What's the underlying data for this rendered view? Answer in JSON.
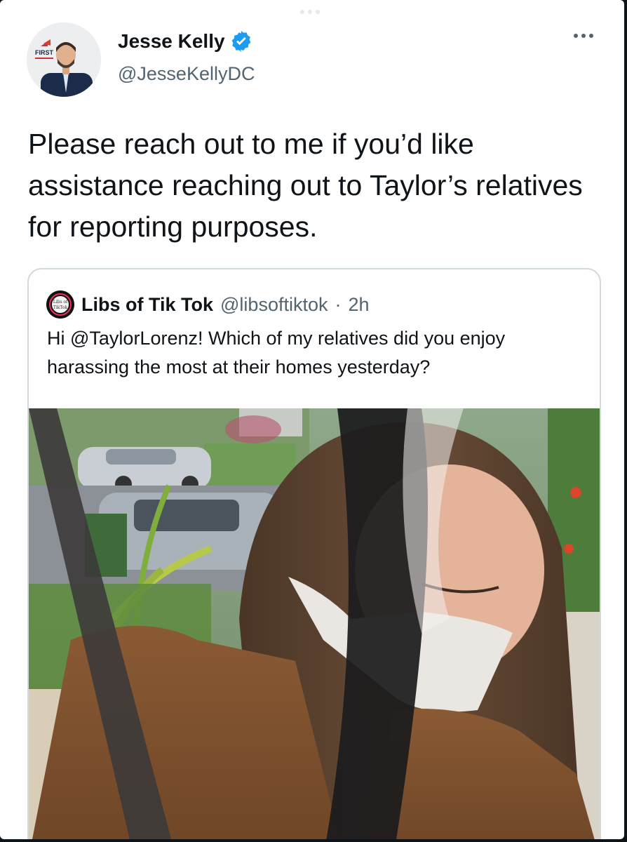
{
  "tweet": {
    "author_name": "Jesse Kelly",
    "author_handle": "@JesseKellyDC",
    "avatar_badge": "FIRST",
    "verified_icon": "verified-badge-icon",
    "text": "Please reach out to me if you’d like assistance reaching out to Taylor’s relatives for reporting purposes."
  },
  "quote": {
    "author_name": "Libs of Tik Tok",
    "author_handle": "@libsoftiktok",
    "separator": "·",
    "time": "2h",
    "avatar_text": "Libs of TikTok",
    "text": "Hi @TaylorLorenz! Which of my relatives did you enjoy harassing the most at their homes yesterday?"
  },
  "colors": {
    "accent": "#1d9bf0",
    "text": "#0f1419",
    "secondary": "#536471",
    "border": "#cfd9de"
  }
}
